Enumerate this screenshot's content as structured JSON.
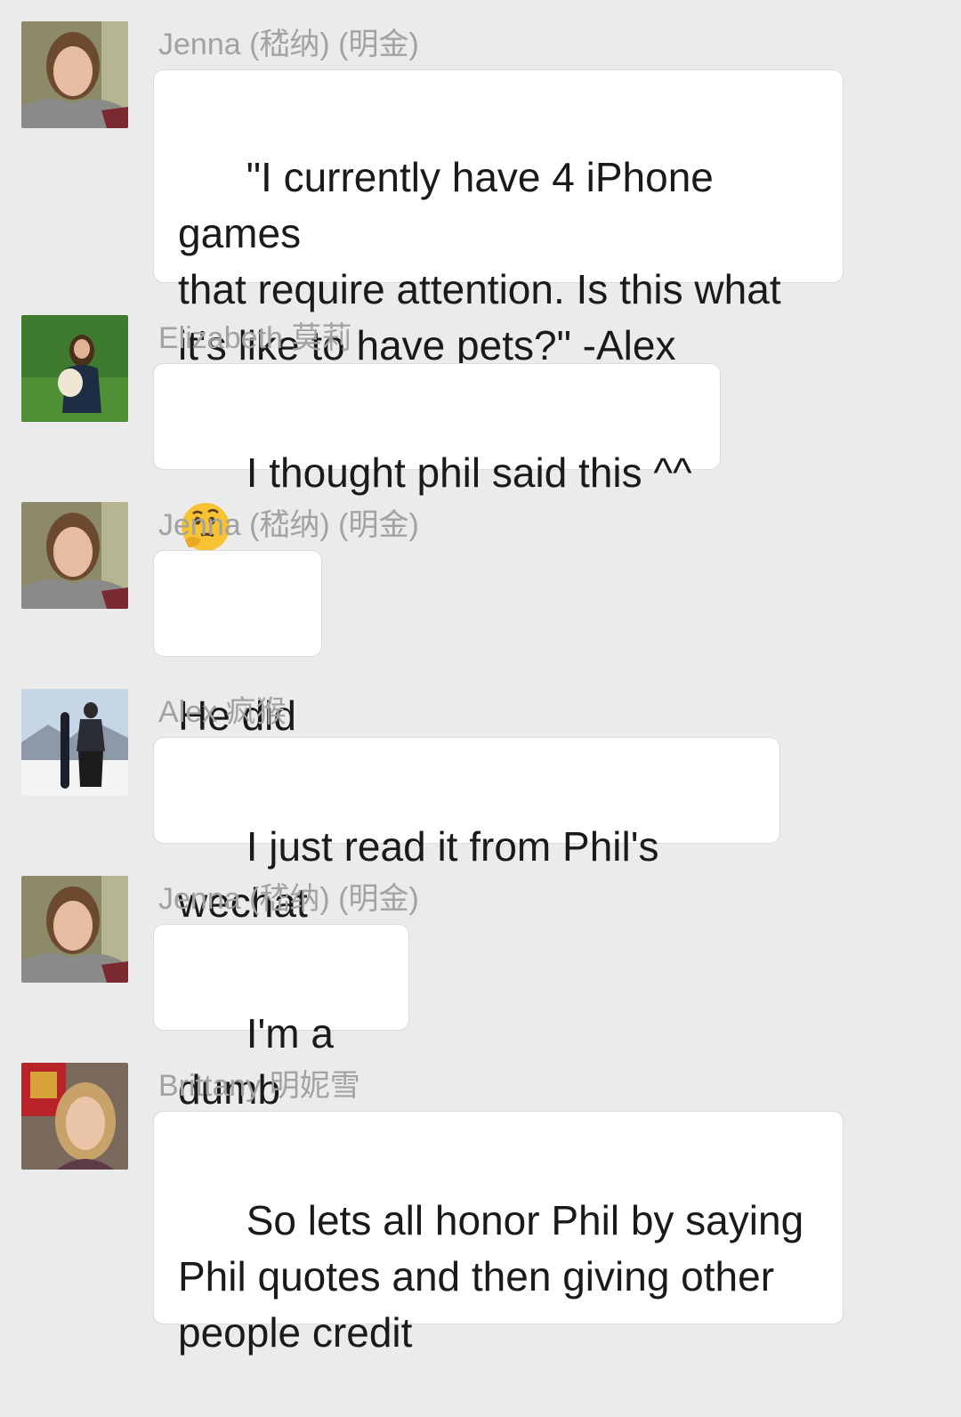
{
  "messages": [
    {
      "sender": "Jenna (嵇纳) (明金)",
      "text": "\"I currently have 4 iPhone games\nthat require attention. Is this what\nit's like to have pets?\" -Alex",
      "avatar": "jenna-avatar"
    },
    {
      "sender": "Elizabeth 莫莉",
      "text": "I thought phil said this ^^",
      "emoji": "thinking-face-emoji",
      "avatar": "elizabeth-avatar"
    },
    {
      "sender": "Jenna (嵇纳) (明金)",
      "text": "He did",
      "avatar": "jenna-avatar"
    },
    {
      "sender": "Alex 疯猴",
      "text": "I just read it from Phil's wechat",
      "avatar": "alex-avatar"
    },
    {
      "sender": "Jenna (嵇纳) (明金)",
      "text": "I'm a dumb",
      "avatar": "jenna-avatar"
    },
    {
      "sender": "Brittany 明妮雪",
      "text": "So lets all honor Phil by saying\nPhil quotes and then giving other\npeople credit",
      "avatar": "brittany-avatar"
    }
  ],
  "colors": {
    "background": "#ebebeb",
    "bubble": "#ffffff",
    "bubble_border": "#dcdcdc",
    "sender_name": "#a2a2a2",
    "message_text": "#1a1a1a"
  }
}
